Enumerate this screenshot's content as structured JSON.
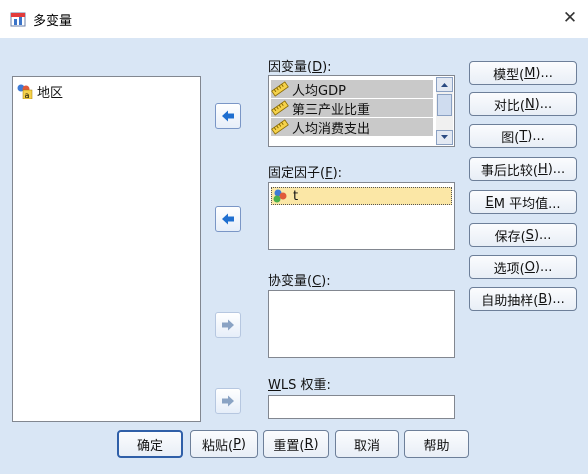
{
  "window": {
    "title": "多变量",
    "close_glyph": "✕"
  },
  "source_list": {
    "items": [
      {
        "label": "地区",
        "icon": "nominal-variable-icon"
      }
    ]
  },
  "dependent": {
    "label_pre": "因变量(",
    "label_key": "D",
    "label_post": "):",
    "items": [
      {
        "label": "人均GDP",
        "icon": "scale-variable-icon"
      },
      {
        "label": "第三产业比重",
        "icon": "scale-variable-icon"
      },
      {
        "label": "人均消费支出",
        "icon": "scale-variable-icon"
      }
    ]
  },
  "fixed": {
    "label_pre": "固定因子(",
    "label_key": "F",
    "label_post": "):",
    "items": [
      {
        "label": "t",
        "icon": "nominal-factor-icon"
      }
    ]
  },
  "covariate": {
    "label_pre": "协变量(",
    "label_key": "C",
    "label_post": "):"
  },
  "wls": {
    "label_key": "W",
    "label_post": "LS 权重:"
  },
  "side_buttons": [
    {
      "pre": "模型(",
      "key": "M",
      "post": ")..."
    },
    {
      "pre": "对比(",
      "key": "N",
      "post": ")..."
    },
    {
      "pre": "图(",
      "key": "T",
      "post": ")..."
    },
    {
      "pre": "事后比较(",
      "key": "H",
      "post": ")..."
    },
    {
      "pre": "",
      "key": "E",
      "post": "M 平均值..."
    },
    {
      "pre": "保存(",
      "key": "S",
      "post": ")..."
    },
    {
      "pre": "选项(",
      "key": "O",
      "post": ")..."
    },
    {
      "pre": "自助抽样(",
      "key": "B",
      "post": ")..."
    }
  ],
  "bottom_buttons": [
    {
      "label": "确定"
    },
    {
      "pre": "粘贴(",
      "key": "P",
      "post": ")"
    },
    {
      "pre": "重置(",
      "key": "R",
      "post": ")"
    },
    {
      "label": "取消"
    },
    {
      "label": "帮助"
    }
  ],
  "colors": {
    "selection": "#fbe7a6",
    "client_bg": "#d9e6f5",
    "arrow_blue": "#1f6fd0"
  }
}
